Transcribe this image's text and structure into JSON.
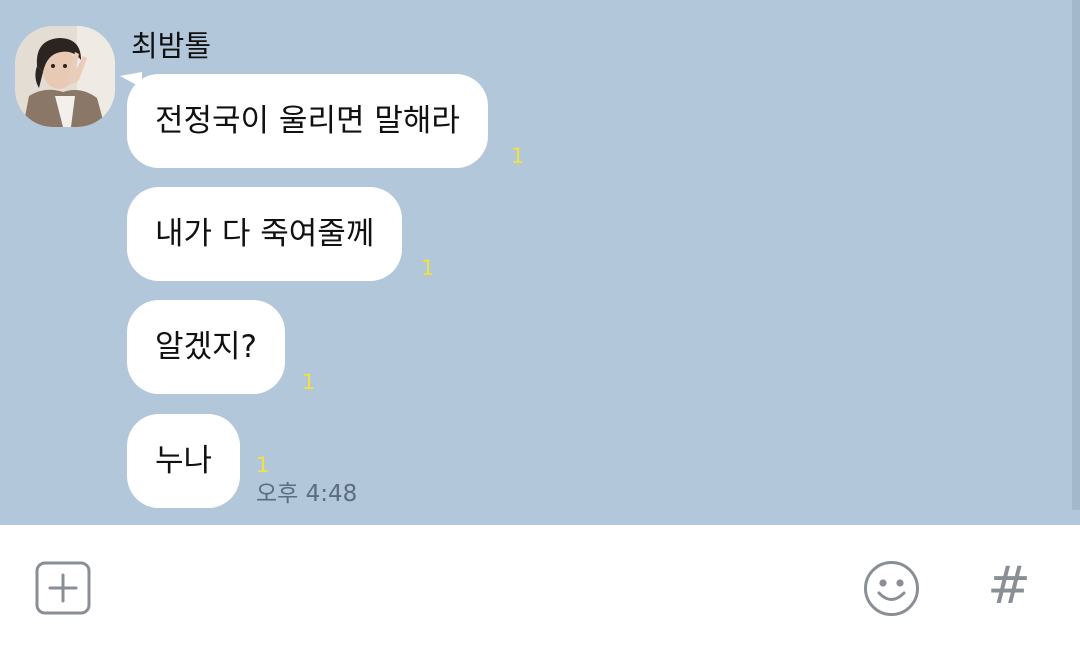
{
  "chat": {
    "sender_name": "최밤톨",
    "messages": [
      {
        "text": "전정국이 울리면 말해라",
        "unread": "1"
      },
      {
        "text": "내가 다 죽여줄께",
        "unread": "1"
      },
      {
        "text": "알겠지?",
        "unread": "1"
      },
      {
        "text": "누나",
        "unread": "1"
      }
    ],
    "timestamp": "오후 4:48"
  },
  "input_bar": {
    "add_icon": "plus-square-icon",
    "emoji_icon": "smiley-icon",
    "hash_icon": "hashtag-icon",
    "hash_glyph": "#"
  },
  "colors": {
    "chat_background": "#b2c7da",
    "bubble": "#ffffff",
    "unread_badge": "#f1e23d",
    "timestamp": "#5b6d7e",
    "icon": "#8a8f96"
  }
}
